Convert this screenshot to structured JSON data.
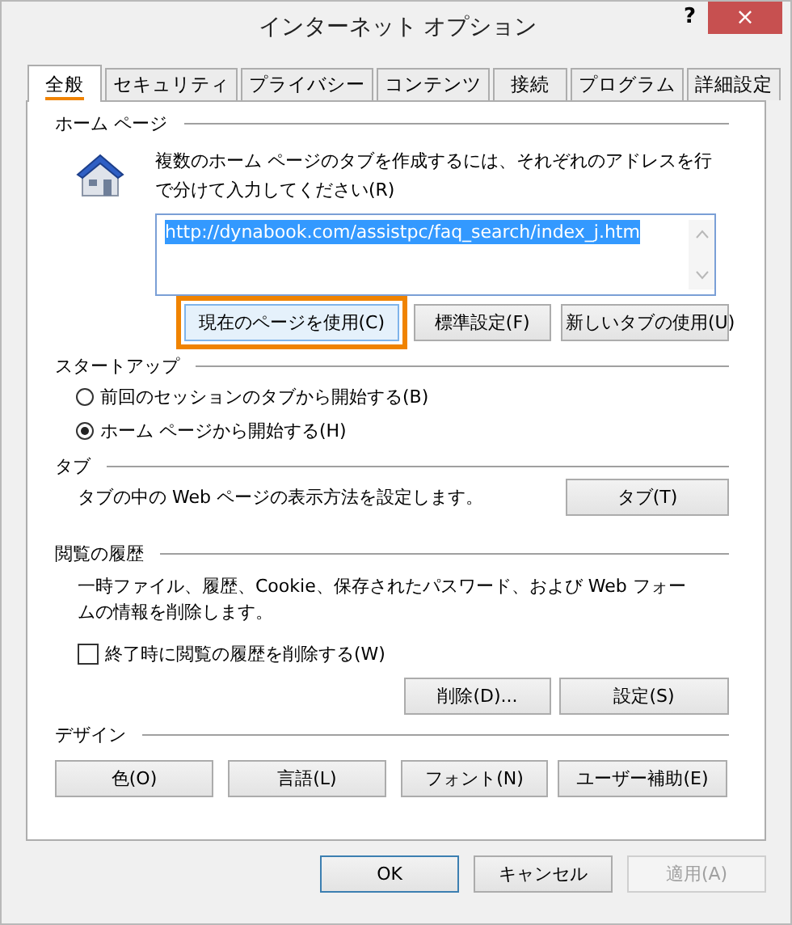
{
  "window": {
    "title": "インターネット オプション",
    "help": "?",
    "close": "×"
  },
  "tabs": [
    {
      "label": "全般",
      "selected": true
    },
    {
      "label": "セキュリティ",
      "selected": false
    },
    {
      "label": "プライバシー",
      "selected": false
    },
    {
      "label": "コンテンツ",
      "selected": false
    },
    {
      "label": "接続",
      "selected": false
    },
    {
      "label": "プログラム",
      "selected": false
    },
    {
      "label": "詳細設定",
      "selected": false
    }
  ],
  "home_page": {
    "heading": "ホーム ページ",
    "description": "複数のホーム ページのタブを作成するには、それぞれのアドレスを行で分けて入力してください(R)",
    "url": {
      "value": "http://dynabook.com/assistpc/faq_search/index_j.htm",
      "selected": true
    },
    "buttons": [
      {
        "label": "現在のページを使用(C)",
        "highlighted": true
      },
      {
        "label": "標準設定(F)",
        "highlighted": false
      },
      {
        "label": "新しいタブの使用(U)",
        "highlighted": false
      }
    ]
  },
  "startup": {
    "heading": "スタートアップ",
    "options": [
      {
        "label": "前回のセッションのタブから開始する(B)",
        "selected": false
      },
      {
        "label": "ホーム ページから開始する(H)",
        "selected": true
      }
    ]
  },
  "tabs_section": {
    "heading": "タブ",
    "description": "タブの中の Web ページの表示方法を設定します。",
    "button": "タブ(T)"
  },
  "history": {
    "heading": "閲覧の履歴",
    "description": "一時ファイル、履歴、Cookie、保存されたパスワード、および Web フォームの情報を削除します。",
    "checkbox": {
      "label": "終了時に閲覧の履歴を削除する(W)",
      "checked": false
    },
    "buttons": [
      "削除(D)...",
      "設定(S)"
    ]
  },
  "design": {
    "heading": "デザイン",
    "buttons": [
      "色(O)",
      "言語(L)",
      "フォント(N)",
      "ユーザー補助(E)"
    ]
  },
  "footer": [
    {
      "label": "OK",
      "default": true,
      "disabled": false
    },
    {
      "label": "キャンセル",
      "default": false,
      "disabled": false
    },
    {
      "label": "適用(A)",
      "default": false,
      "disabled": true
    }
  ]
}
